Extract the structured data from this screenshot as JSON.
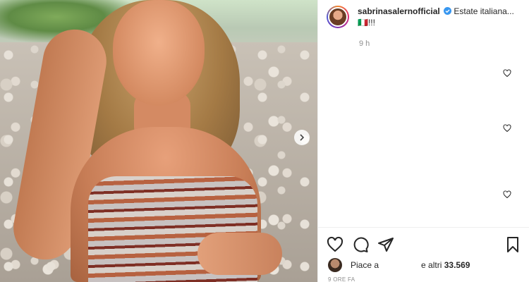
{
  "post": {
    "username": "sabrinasalernofficial",
    "caption": "Estate italiana...🇮🇹!!!",
    "time": "9 h",
    "likes_prefix": "Piace a",
    "likes_suffix": "e altri",
    "likes_count": "33.569",
    "date": "9 ORE FA"
  },
  "icons": {
    "verified": "verified-badge-icon",
    "next": "chevron-right-icon",
    "like": "heart-icon",
    "comment": "comment-icon",
    "share": "paper-plane-icon",
    "save": "bookmark-icon"
  },
  "colors": {
    "verified": "#3897f0",
    "muted": "#8e8e8e",
    "text": "#262626"
  }
}
